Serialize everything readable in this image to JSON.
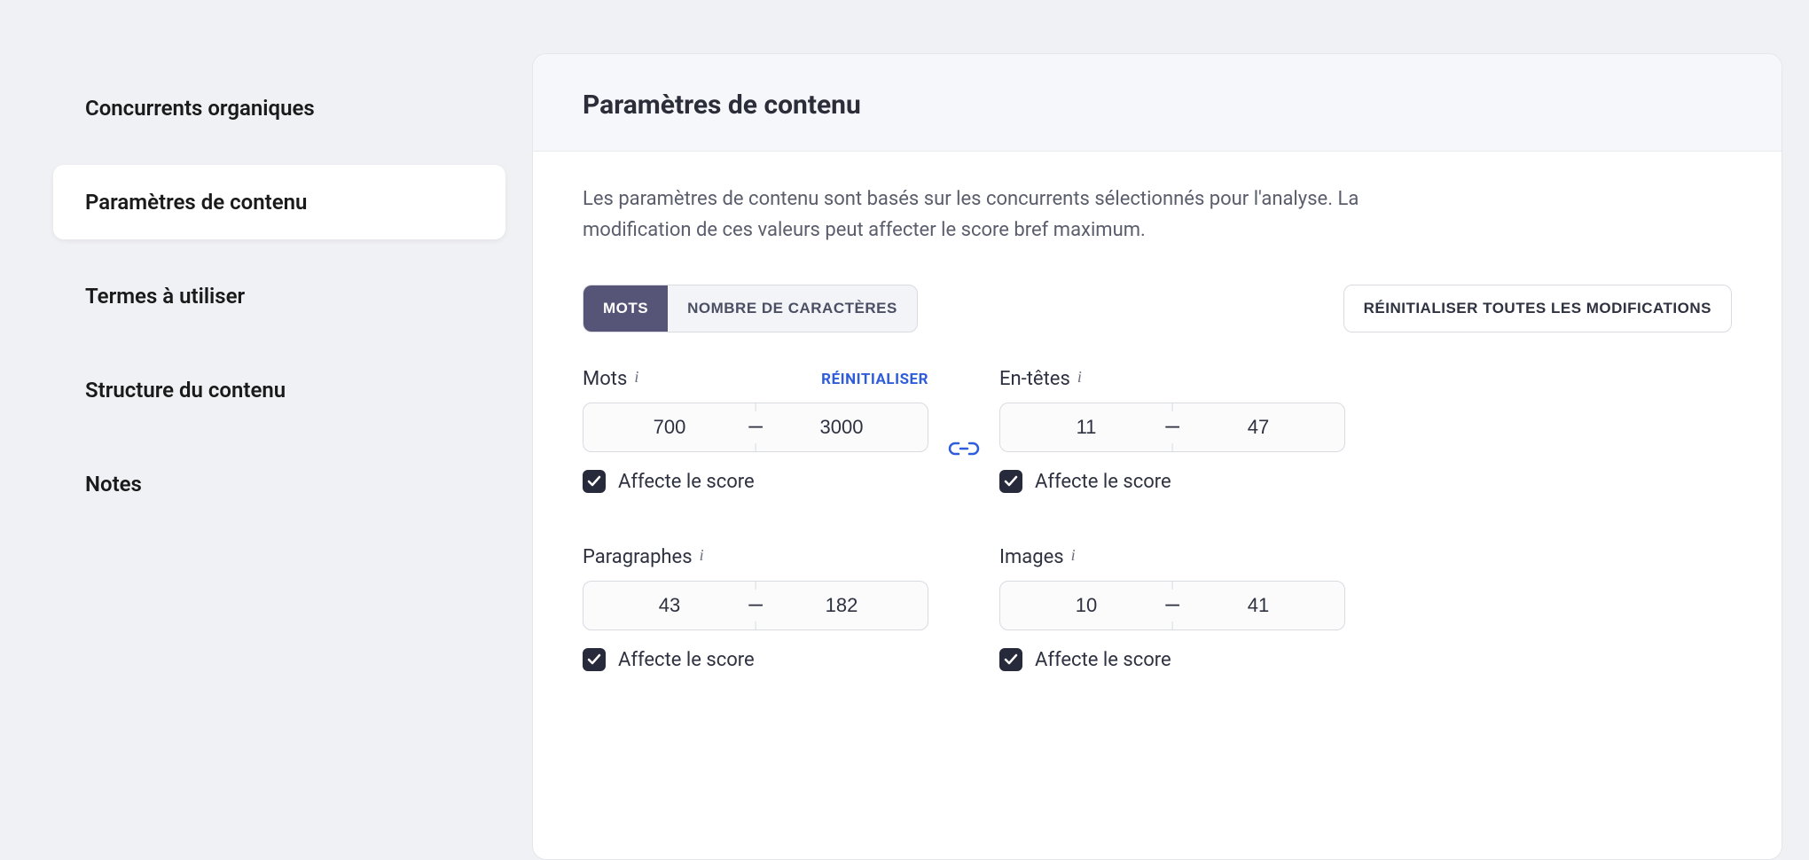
{
  "sidebar": {
    "items": [
      {
        "label": "Concurrents organiques",
        "active": false
      },
      {
        "label": "Paramètres de contenu",
        "active": true
      },
      {
        "label": "Termes à utiliser",
        "active": false
      },
      {
        "label": "Structure du contenu",
        "active": false
      },
      {
        "label": "Notes",
        "active": false
      }
    ]
  },
  "panel": {
    "title": "Paramètres de contenu",
    "description": "Les paramètres de contenu sont basés sur les concurrents sélectionnés pour l'analyse. La modification de ces valeurs peut affecter le score bref maximum."
  },
  "segmented": {
    "tab_words": "MOTS",
    "tab_chars": "NOMBRE DE CARACTÈRES",
    "active": "words"
  },
  "buttons": {
    "reset_all": "RÉINITIALISER TOUTES LES MODIFICATIONS"
  },
  "fields": {
    "words": {
      "label": "Mots",
      "reset_label": "RÉINITIALISER",
      "min": "700",
      "max": "3000",
      "affects_label": "Affecte le score",
      "affects_checked": true
    },
    "headers": {
      "label": "En-têtes",
      "min": "11",
      "max": "47",
      "affects_label": "Affecte le score",
      "affects_checked": true
    },
    "paragraphs": {
      "label": "Paragraphes",
      "min": "43",
      "max": "182",
      "affects_label": "Affecte le score",
      "affects_checked": true
    },
    "images": {
      "label": "Images",
      "min": "10",
      "max": "41",
      "affects_label": "Affecte le score",
      "affects_checked": true
    }
  }
}
